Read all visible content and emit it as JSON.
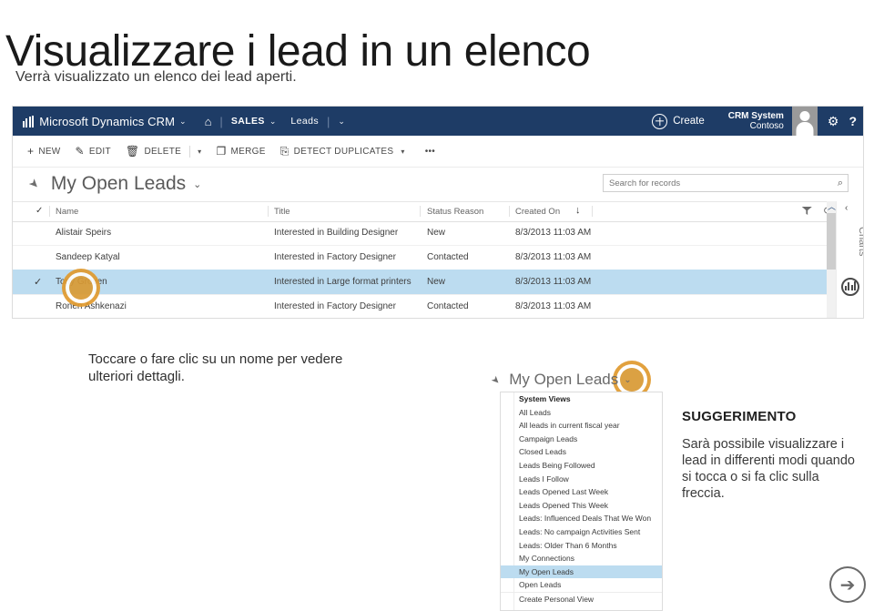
{
  "page": {
    "title": "Visualizzare i lead in un elenco",
    "subtitle": "Verrà visualizzato un elenco dei lead aperti.",
    "caption": "Toccare o fare clic su un nome per vedere ulteriori dettagli."
  },
  "crm": {
    "nav": {
      "brand": "Microsoft Dynamics CRM",
      "brand_caret": "⌄",
      "home_icon": "⌂",
      "separator": "|",
      "area": "SALES",
      "area_caret": "⌄",
      "entity": "Leads",
      "entity_caret": "⌄",
      "create_label": "Create",
      "user_line1": "CRM System",
      "user_line2": "Contoso",
      "gear_icon": "⚙",
      "help_icon": "?"
    },
    "commands": [
      {
        "icon": "+",
        "label": "NEW",
        "caret": false
      },
      {
        "icon": "✎",
        "label": "EDIT",
        "caret": false
      },
      {
        "icon": "🗑",
        "label": "DELETE",
        "caret": true
      },
      {
        "icon": "❐",
        "label": "MERGE",
        "caret": false
      },
      {
        "icon": "⎘",
        "label": "DETECT DUPLICATES",
        "caret": true
      },
      {
        "icon": "",
        "label": "•••",
        "caret": false
      }
    ],
    "view": {
      "pin_icon": "➤",
      "name": "My Open Leads",
      "caret": "⌄"
    },
    "search": {
      "placeholder": "Search for records",
      "icon": "⌕"
    },
    "grid": {
      "columns": [
        "Name",
        "Title",
        "Status Reason",
        "Created On"
      ],
      "sort_indicator": "↓",
      "select_all_icon": "✓",
      "rows": [
        {
          "checked": "",
          "name": "Alistair Speirs",
          "title": "Interested in Building Designer",
          "status": "New",
          "created": "8/3/2013 11:03 AM",
          "selected": false
        },
        {
          "checked": "",
          "name": "Sandeep Katyal",
          "title": "Interested in Factory Designer",
          "status": "Contacted",
          "created": "8/3/2013 11:03 AM",
          "selected": false
        },
        {
          "checked": "✓",
          "name": "Tony Groven",
          "title": "Interested in Large format printers",
          "status": "New",
          "created": "8/3/2013 11:03 AM",
          "selected": true
        },
        {
          "checked": "",
          "name": "Ronen Ashkenazi",
          "title": "Interested in Factory Designer",
          "status": "Contacted",
          "created": "8/3/2013 11:03 AM",
          "selected": false
        }
      ]
    },
    "rail": {
      "collapse_icon": "‹",
      "label": "Charts"
    },
    "scroll_up_icon": "︿",
    "refresh_icon": "⟳"
  },
  "dropdown": {
    "pin_icon": "➤",
    "title": "My Open Leads",
    "caret": "⌄",
    "items": [
      {
        "label": "System Views",
        "header": true,
        "selected": false,
        "divider": false
      },
      {
        "label": "All Leads",
        "header": false,
        "selected": false,
        "divider": false
      },
      {
        "label": "All leads in current fiscal year",
        "header": false,
        "selected": false,
        "divider": false
      },
      {
        "label": "Campaign Leads",
        "header": false,
        "selected": false,
        "divider": false
      },
      {
        "label": "Closed Leads",
        "header": false,
        "selected": false,
        "divider": false
      },
      {
        "label": "Leads Being Followed",
        "header": false,
        "selected": false,
        "divider": false
      },
      {
        "label": "Leads I Follow",
        "header": false,
        "selected": false,
        "divider": false
      },
      {
        "label": "Leads Opened Last Week",
        "header": false,
        "selected": false,
        "divider": false
      },
      {
        "label": "Leads Opened This Week",
        "header": false,
        "selected": false,
        "divider": false
      },
      {
        "label": "Leads: Influenced Deals That We Won",
        "header": false,
        "selected": false,
        "divider": false
      },
      {
        "label": "Leads: No campaign Activities Sent",
        "header": false,
        "selected": false,
        "divider": false
      },
      {
        "label": "Leads: Older Than 6 Months",
        "header": false,
        "selected": false,
        "divider": false
      },
      {
        "label": "My Connections",
        "header": false,
        "selected": false,
        "divider": false
      },
      {
        "label": "My Open Leads",
        "header": false,
        "selected": true,
        "divider": false
      },
      {
        "label": "Open Leads",
        "header": false,
        "selected": false,
        "divider": false
      },
      {
        "label": "Create Personal View",
        "header": false,
        "selected": false,
        "divider": true
      }
    ]
  },
  "tip": {
    "heading": "SUGGERIMENTO",
    "body": "Sarà possibile visualizzare i lead in differenti modi quando si tocca o si fa clic sulla freccia."
  },
  "next": {
    "icon": "➔"
  },
  "colors": {
    "nav_blue": "#1e3c66",
    "selection_blue": "#bcdcf0",
    "tap_orange": "#d99a34",
    "tap_ring": "#e09a2e"
  }
}
